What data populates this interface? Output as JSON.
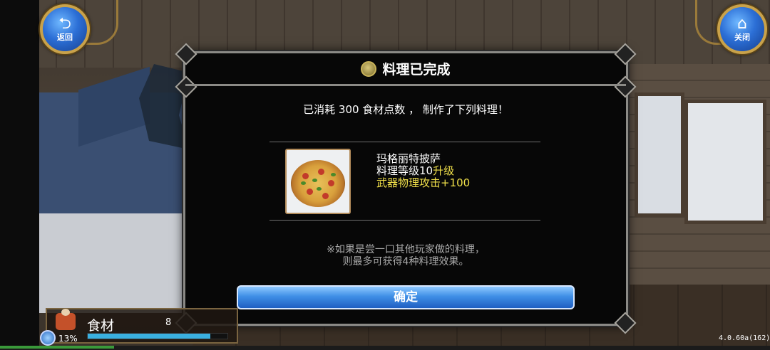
{
  "buttons": {
    "back": {
      "icon": "back-arrow-icon",
      "glyph": "⮌",
      "label": "返回"
    },
    "close": {
      "icon": "home-icon",
      "glyph": "⌂",
      "label": "关闭"
    }
  },
  "dialog": {
    "title": "料理已完成",
    "title_icon": "cooking-pot-icon",
    "message": "已消耗 300 食材点数 ， 制作了下列料理！",
    "dish": {
      "name": "玛格丽特披萨",
      "level_prefix": "料理等级10",
      "level_suffix": "升级",
      "effect": "武器物理攻击+100",
      "image": "pizza-icon"
    },
    "note_line1": "※如果是尝一口其他玩家做的料理，",
    "note_line2": "则最多可获得4种料理效果。",
    "confirm_label": "确定"
  },
  "ingredients": {
    "label": "食材",
    "count": "8",
    "bar_fill_percent": 88,
    "icon": "ingredients-icon"
  },
  "status": {
    "percent": "13%",
    "icon": "globe-icon"
  },
  "version": "4.0.60a(162)",
  "colors": {
    "accent_yellow": "#f0e04a",
    "button_blue": "#3f8fe6",
    "bar_blue": "#3ab0e0"
  }
}
